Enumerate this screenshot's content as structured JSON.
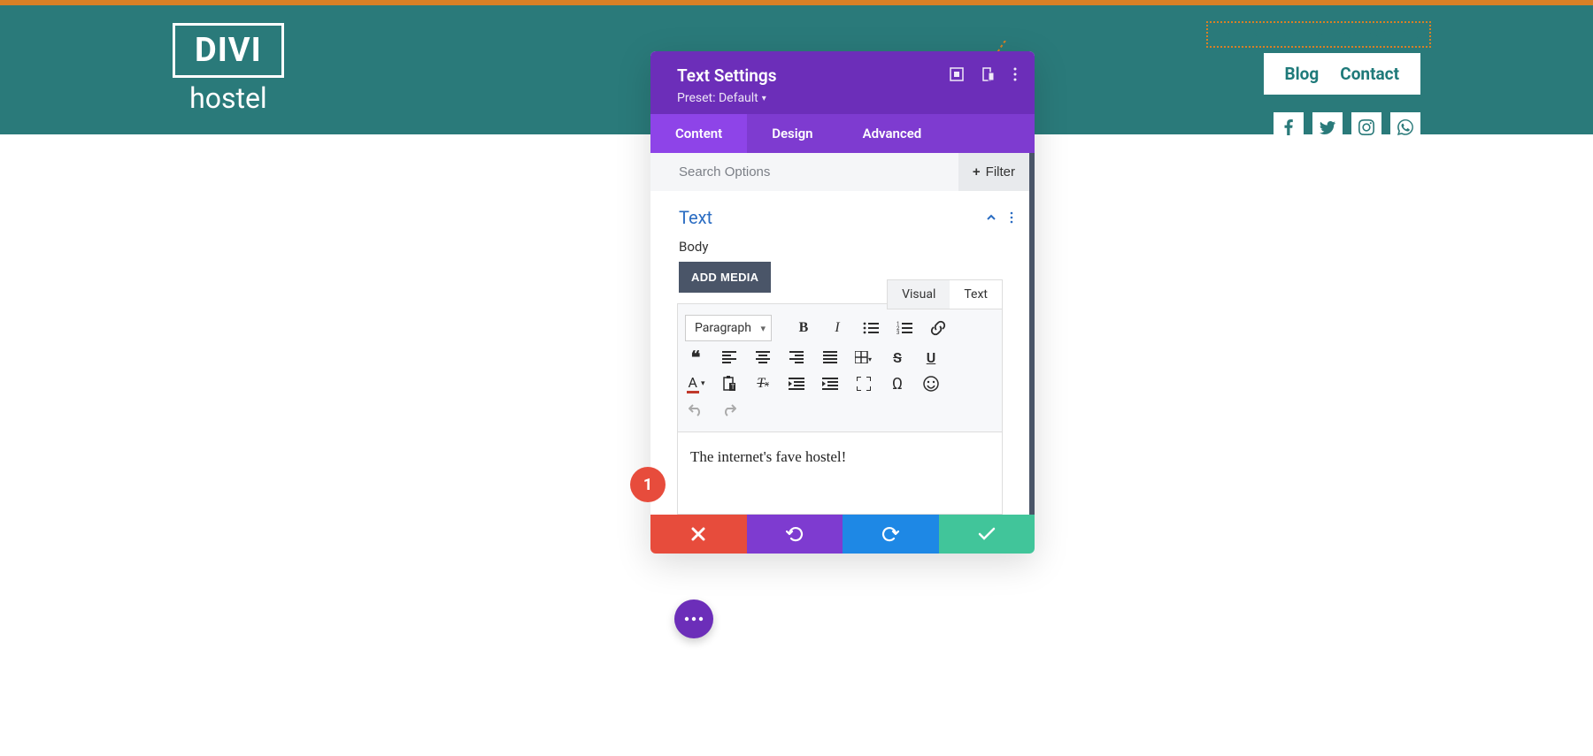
{
  "header": {
    "logo_main": "DIVI",
    "logo_sub": "hostel",
    "tagline": "THE INTERNET'S FAVE HOSTEL!",
    "nav": [
      "Blog",
      "Contact"
    ],
    "social": [
      "facebook",
      "twitter",
      "instagram",
      "whatsapp"
    ]
  },
  "panel": {
    "title": "Text Settings",
    "preset": "Preset: Default",
    "tabs": [
      "Content",
      "Design",
      "Advanced"
    ],
    "active_tab": 0,
    "search_placeholder": "Search Options",
    "filter_label": "Filter",
    "section_title": "Text",
    "body_label": "Body",
    "add_media": "ADD MEDIA",
    "vt_tabs": [
      "Visual",
      "Text"
    ],
    "vt_active": 0,
    "format": "Paragraph",
    "content": "The internet's fave hostel!",
    "toolbar_icons": {
      "bold": "bold-icon",
      "italic": "italic-icon",
      "ul": "ul-icon",
      "ol": "ol-icon",
      "link": "link-icon",
      "quote": "quote-icon",
      "alignl": "align-left-icon",
      "alignc": "align-center-icon",
      "alignr": "align-right-icon",
      "alignj": "align-justify-icon",
      "table": "table-icon",
      "strike": "strikethrough-icon",
      "underline": "underline-icon",
      "textcolor": "text-color-icon",
      "paste": "paste-icon",
      "clear": "clear-format-icon",
      "outdent": "outdent-icon",
      "indent": "indent-icon",
      "fullscreen": "fullscreen-icon",
      "special": "special-char-icon",
      "emoji": "emoji-icon",
      "undo": "undo-icon",
      "redo": "redo-icon"
    }
  },
  "step_badge": "1",
  "colors": {
    "teal": "#2a7a7a",
    "orange": "#d88026",
    "purple": "#6c2eb9",
    "purple_light": "#7e3bd0"
  }
}
